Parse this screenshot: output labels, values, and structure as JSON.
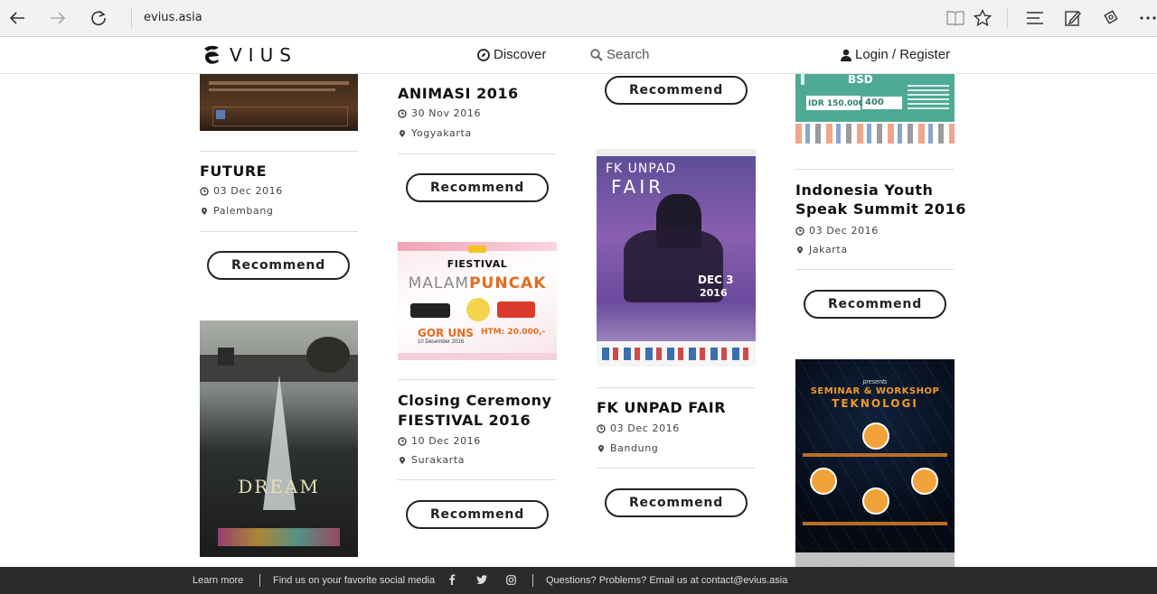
{
  "browser": {
    "url": "evius.asia"
  },
  "header": {
    "logo_text": "VIUS",
    "nav": {
      "discover": "Discover",
      "search": "Search",
      "login": "Login / Register"
    }
  },
  "events": [
    {
      "title_lines": [
        "FUTURE"
      ],
      "date": "03 Dec 2016",
      "location": "Palembang",
      "button": "Recommend"
    },
    {
      "title_lines": [
        "ANIMASI 2016"
      ],
      "date": "30 Nov 2016",
      "location": "Yogyakarta",
      "button": "Recommend"
    },
    {
      "title_lines": [
        "Closing Ceremony",
        "FIESTIVAL 2016"
      ],
      "date": "10 Dec 2016",
      "location": "Surakarta",
      "button": "Recommend"
    },
    {
      "title_lines": [
        "FK UNPAD FAIR"
      ],
      "date": "03 Dec 2016",
      "location": "Bandung",
      "button": "Recommend"
    },
    {
      "title_lines": [
        "Indonesia Youth",
        "Speak Summit 2016"
      ],
      "date": "03 Dec 2016",
      "location": "Jakarta",
      "button": "Recommend"
    },
    {
      "button": "Recommend"
    }
  ],
  "posters": {
    "dream": {
      "text": "DREAM"
    },
    "fiestival": {
      "brand": "FIESTIVAL",
      "headline_a": "MALAM",
      "headline_b": "PUNCAK",
      "venue": "GOR UNS",
      "date": "10 Desember 2016",
      "price": "HTM: 20.000,-"
    },
    "fkunpad": {
      "title": "FK UNPAD",
      "sub": "FAIR",
      "date": "DEC 3",
      "year": "2016"
    },
    "youth": {
      "price": "IDR 150.000",
      "bsd": "BSD",
      "num": "400"
    },
    "seminar": {
      "pre": "presents",
      "line1": "SEMINAR & WORKSHOP",
      "line2": "TEKNOLOGI"
    }
  },
  "footer": {
    "learn_more": "Learn more",
    "social": "Find us on your favorite social media",
    "contact": "Questions? Problems? Email us at  contact@evius.asia"
  }
}
